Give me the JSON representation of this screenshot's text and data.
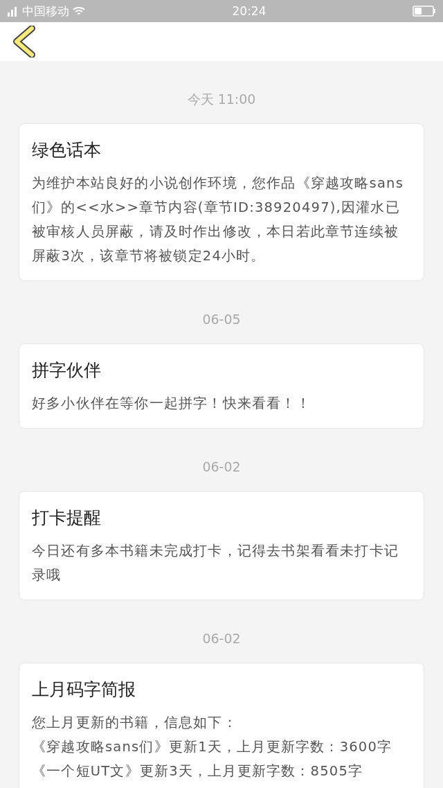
{
  "status_bar": {
    "carrier": "中国移动",
    "time": "20:24"
  },
  "messages": [
    {
      "date": "今天 11:00",
      "title": "绿色话本",
      "paragraphs": [
        "为维护本站良好的小说创作环境，您作品《穿越攻略sans们》的<<水>>章节内容(章节ID:38920497),因灌水已被审核人员屏蔽，请及时作出修改，本日若此章节连续被屏蔽3次，该章节将被锁定24小时。"
      ]
    },
    {
      "date": "06-05",
      "title": "拼字伙伴",
      "paragraphs": [
        "好多小伙伴在等你一起拼字！快来看看！！"
      ]
    },
    {
      "date": "06-02",
      "title": "打卡提醒",
      "paragraphs": [
        "今日还有多本书籍未完成打卡，记得去书架看看未打卡记录哦"
      ]
    },
    {
      "date": "06-02",
      "title": "上月码字简报",
      "paragraphs": [
        "您上月更新的书籍，信息如下：",
        "《穿越攻略sans们》更新1天，上月更新字数：3600字",
        "《一个短UT文》更新3天，上月更新字数：8505字"
      ]
    }
  ]
}
